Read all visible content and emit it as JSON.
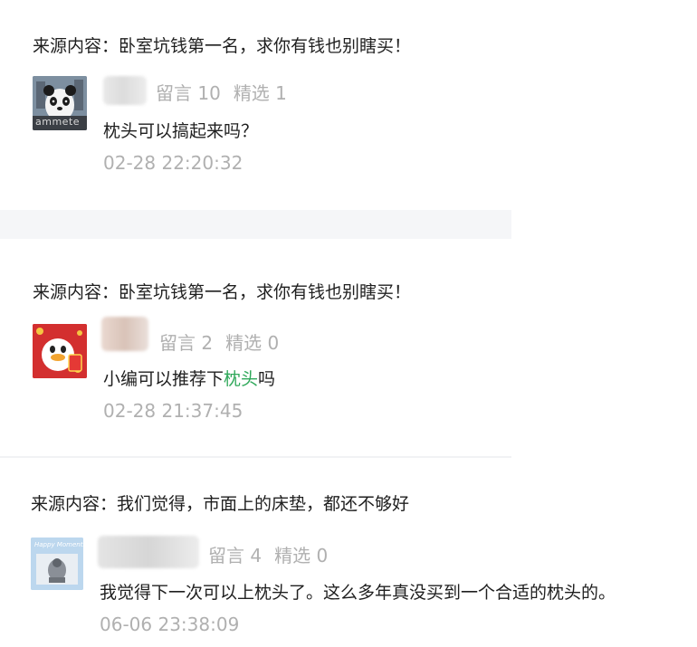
{
  "comments": [
    {
      "source": "来源内容：卧室坑钱第一名，求你有钱也别瞎买！",
      "messages_label": "留言 10",
      "featured_label": "精选 1",
      "comment_pre": "枕头可以搞起来吗？",
      "comment_kw": "",
      "comment_post": "",
      "time": "02-28 22:20:32",
      "avatar": "panda-avatar"
    },
    {
      "source": "来源内容：卧室坑钱第一名，求你有钱也别瞎买！",
      "messages_label": "留言 2",
      "featured_label": "精选 0",
      "comment_pre": "小编可以推荐下",
      "comment_kw": "枕头",
      "comment_post": "吗",
      "time": "02-28 21:37:45",
      "avatar": "duck-avatar"
    },
    {
      "source": "来源内容：我们觉得，市面上的床垫，都还不够好",
      "messages_label": "留言 4",
      "featured_label": "精选 0",
      "comment_pre": "我觉得下一次可以上枕头了。这么多年真没买到一个合适的枕头的。",
      "comment_kw": "",
      "comment_post": "",
      "time": "06-06 23:38:09",
      "avatar": "happy-moments-avatar"
    }
  ],
  "avatar_text": {
    "panda_caption": "ammete",
    "happy_title": "Happy Moments"
  },
  "colors": {
    "keyword": "#2fa85a",
    "meta": "#b0b0b0",
    "divider": "#f5f6f8"
  }
}
